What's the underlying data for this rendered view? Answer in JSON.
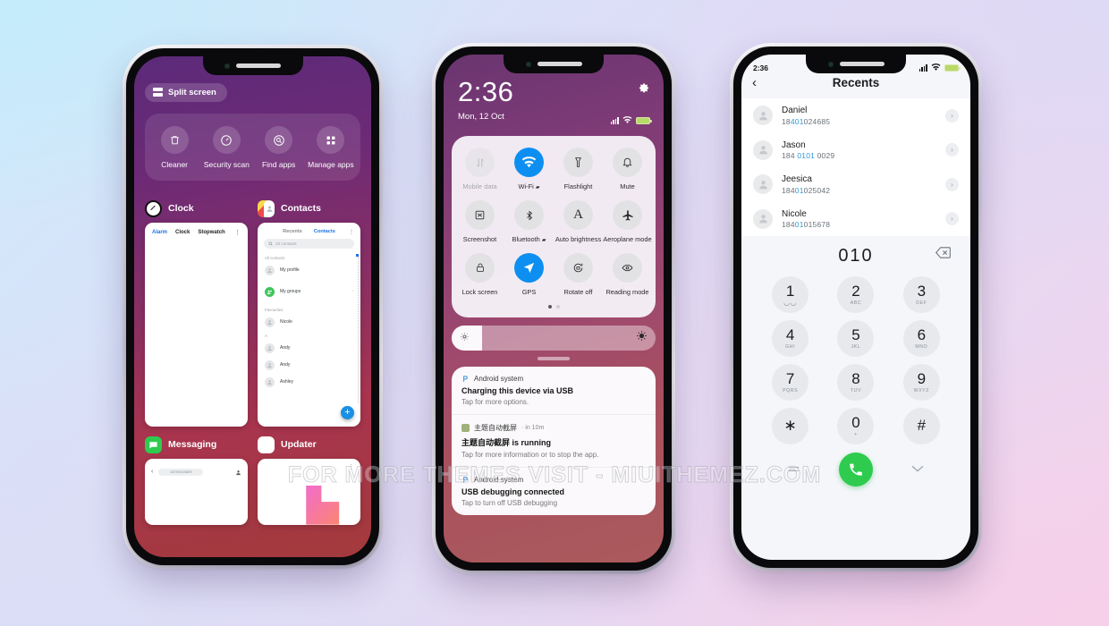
{
  "watermark": "FOR MORE THEMES VISIT - MIUITHEMEZ.COM",
  "colors": {
    "accent_blue": "#0d8ff2",
    "call_green": "#2ecb4f",
    "number_highlight": "#2f9ad6"
  },
  "phone1": {
    "split_screen_label": "Split screen",
    "tools": [
      {
        "label": "Cleaner",
        "icon": "trash-icon"
      },
      {
        "label": "Security scan",
        "icon": "shield-clock-icon"
      },
      {
        "label": "Find apps",
        "icon": "search-circle-icon"
      },
      {
        "label": "Manage apps",
        "icon": "grid-apps-icon"
      }
    ],
    "cards": [
      {
        "app": "Clock",
        "tabs": [
          "Alarm",
          "Clock",
          "Stopwatch"
        ],
        "active_tab": "Alarm",
        "menu": "overflow-icon"
      },
      {
        "app": "Contacts",
        "tabs": [
          "Recents",
          "Contacts"
        ],
        "active_tab": "Contacts",
        "search_placeholder": "23 contacts",
        "sections": [
          {
            "header": "All contacts",
            "rows": [
              {
                "name": "My profile"
              }
            ]
          },
          {
            "header": "",
            "rows": [
              {
                "name": "My groups",
                "chevron": true
              }
            ]
          },
          {
            "header": "Favourites",
            "rows": [
              {
                "name": "Nicole"
              }
            ]
          },
          {
            "header": "A",
            "rows": [
              {
                "name": "Andy"
              },
              {
                "name": "Andy"
              },
              {
                "name": "Ashley"
              }
            ]
          }
        ],
        "fab": "+"
      },
      {
        "app": "Messaging",
        "field": "18700019809"
      },
      {
        "app": "Updater",
        "menu": "overflow-icon"
      }
    ],
    "close_label": "×"
  },
  "phone2": {
    "time": "2:36",
    "date": "Mon, 12 Oct",
    "settings_icon": "gear-icon",
    "toggles": [
      {
        "label": "Mobile data",
        "icon": "mobile-data-icon",
        "state": "disabled"
      },
      {
        "label": "Wi-Fi",
        "icon": "wifi-icon",
        "state": "on"
      },
      {
        "label": "Flashlight",
        "icon": "flashlight-icon",
        "state": "off"
      },
      {
        "label": "Mute",
        "icon": "bell-icon",
        "state": "off"
      },
      {
        "label": "Screenshot",
        "icon": "screenshot-icon",
        "state": "off"
      },
      {
        "label": "Bluetooth",
        "icon": "bluetooth-icon",
        "state": "off"
      },
      {
        "label": "Auto brightness",
        "icon": "auto-brightness-icon",
        "state": "off"
      },
      {
        "label": "Aeroplane mode",
        "icon": "airplane-icon",
        "state": "off"
      },
      {
        "label": "Lock screen",
        "icon": "lock-icon",
        "state": "off"
      },
      {
        "label": "GPS",
        "icon": "location-arrow-icon",
        "state": "on"
      },
      {
        "label": "Rotate off",
        "icon": "rotate-lock-icon",
        "state": "off"
      },
      {
        "label": "Reading mode",
        "icon": "eye-icon",
        "state": "off"
      }
    ],
    "page_dots": {
      "count": 2,
      "active": 0
    },
    "brightness": {
      "low_icon": "brightness-low-icon",
      "high_icon": "brightness-high-icon",
      "level_pct": 14
    },
    "notifications": [
      {
        "app": "Android system",
        "app_icon": "android-p-icon",
        "title": "Charging this device via USB",
        "body": "Tap for more options."
      },
      {
        "app": "主题自动截屏",
        "app_icon": "screenshot-app-icon",
        "time": "in 10m",
        "title": "主题自动截屏 is running",
        "body": "Tap for more information or to stop the app."
      },
      {
        "app": "Android system",
        "app_icon": "android-p-icon",
        "title": "USB debugging connected",
        "body": "Tap to turn off USB debugging"
      }
    ]
  },
  "phone3": {
    "status_time": "2:36",
    "back_icon": "chevron-left-icon",
    "title": "Recents",
    "recents": [
      {
        "name": "Daniel",
        "num_pre": "18",
        "num_hl": "401",
        "num_post": "024685"
      },
      {
        "name": "Jason",
        "num_pre": "184 ",
        "num_hl": "0101",
        "num_post": " 0029"
      },
      {
        "name": "Jeesica",
        "num_pre": "184",
        "num_hl": "01",
        "num_post": "025042"
      },
      {
        "name": "Nicole",
        "num_pre": "184",
        "num_hl": "01",
        "num_post": "015678"
      }
    ],
    "dialed_number": "010",
    "delete_icon": "backspace-icon",
    "keys": [
      {
        "digit": "1",
        "sub": "◡◡"
      },
      {
        "digit": "2",
        "sub": "ABC"
      },
      {
        "digit": "3",
        "sub": "DEF"
      },
      {
        "digit": "4",
        "sub": "GHI"
      },
      {
        "digit": "5",
        "sub": "JKL"
      },
      {
        "digit": "6",
        "sub": "MNO"
      },
      {
        "digit": "7",
        "sub": "PQRS"
      },
      {
        "digit": "8",
        "sub": "TUV"
      },
      {
        "digit": "9",
        "sub": "WXYZ"
      },
      {
        "digit": "∗",
        "sub": ""
      },
      {
        "digit": "0",
        "sub": "+"
      },
      {
        "digit": "#",
        "sub": ""
      }
    ],
    "footer": {
      "menu_icon": "menu-lines-icon",
      "call_icon": "phone-handset-icon",
      "collapse_icon": "chevron-down-icon"
    }
  }
}
